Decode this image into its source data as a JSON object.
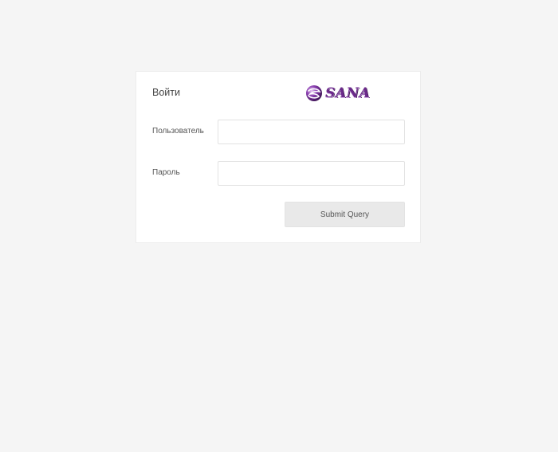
{
  "login": {
    "title": "Войти",
    "logo": {
      "text": "SANA",
      "icon": "sana-globe-logo-icon",
      "primary_color": "#6b2a8a"
    },
    "username_label": "Пользователь",
    "username_value": "",
    "password_label": "Пароль",
    "password_value": "",
    "submit_label": "Submit Query"
  },
  "colors": {
    "page_background": "#f5f5f5",
    "card_background": "#ffffff",
    "button_background": "#e9e9e9"
  }
}
